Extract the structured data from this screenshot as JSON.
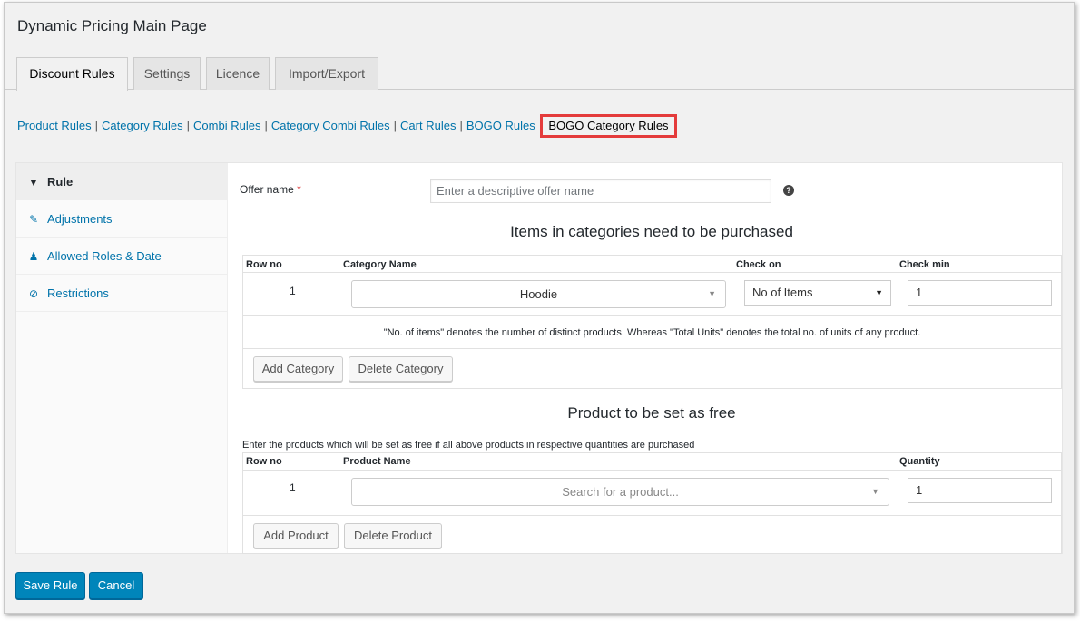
{
  "page": {
    "title": "Dynamic Pricing Main Page"
  },
  "tabs": [
    {
      "label": "Discount Rules",
      "active": true
    },
    {
      "label": "Settings",
      "active": false
    },
    {
      "label": "Licence",
      "active": false
    },
    {
      "label": "Import/Export",
      "active": false
    }
  ],
  "subnav": {
    "links": [
      "Product Rules",
      "Category Rules",
      "Combi Rules",
      "Category Combi Rules",
      "Cart Rules",
      "BOGO Rules"
    ],
    "separator": "|",
    "current": "BOGO Category Rules"
  },
  "sidebar": {
    "items": [
      {
        "label": "Rule",
        "icon": "filter-icon",
        "active": true
      },
      {
        "label": "Adjustments",
        "icon": "pencil-icon",
        "active": false
      },
      {
        "label": "Allowed Roles & Date",
        "icon": "users-icon",
        "active": false
      },
      {
        "label": "Restrictions",
        "icon": "ban-icon",
        "active": false
      }
    ]
  },
  "offer": {
    "label": "Offer name",
    "required_mark": "*",
    "placeholder": "Enter a descriptive offer name",
    "value": "",
    "help": "?"
  },
  "categories_section": {
    "title": "Items in categories need to be purchased",
    "headers": {
      "row_no": "Row no",
      "category_name": "Category Name",
      "check_on": "Check on",
      "check_min": "Check min"
    },
    "rows": [
      {
        "row_no": "1",
        "category": "Hoodie",
        "check_on": "No of Items",
        "check_min": "1"
      }
    ],
    "note": "\"No. of items\" denotes the number of distinct products. Whereas \"Total Units\" denotes the total no. of units of any product.",
    "add_label": "Add Category",
    "delete_label": "Delete Category"
  },
  "free_section": {
    "title": "Product to be set as free",
    "description": "Enter the products which will be set as free if all above products in respective quantities are purchased",
    "headers": {
      "row_no": "Row no",
      "product_name": "Product Name",
      "quantity": "Quantity"
    },
    "rows": [
      {
        "row_no": "1",
        "product_placeholder": "Search for a product...",
        "quantity": "1"
      }
    ],
    "add_label": "Add Product",
    "delete_label": "Delete Product"
  },
  "footer": {
    "save_label": "Save Rule",
    "cancel_label": "Cancel"
  },
  "colors": {
    "link": "#0073aa",
    "primary": "#0085ba",
    "highlight": "#e43b3b"
  }
}
